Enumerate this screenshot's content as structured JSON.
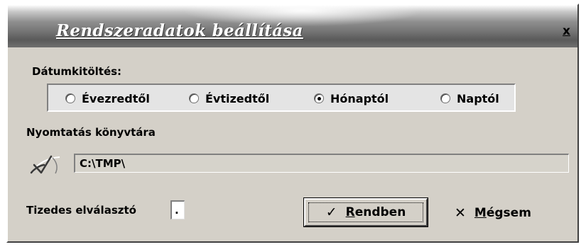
{
  "dialog": {
    "title": "Rendszeradatok beállítása",
    "close_label": "x"
  },
  "date_fill": {
    "label": "Dátumkitöltés:",
    "options": [
      {
        "label": "Évezredtől",
        "selected": false
      },
      {
        "label": "Évtizedtől",
        "selected": false
      },
      {
        "label": "Hónaptól",
        "selected": true
      },
      {
        "label": "Naptól",
        "selected": false
      }
    ]
  },
  "print_dir": {
    "label": "Nyomtatás könyvtára",
    "value": "C:\\TMP\\",
    "browse_icon": "check-icon"
  },
  "decimal": {
    "label": "Tizedes elválasztó",
    "value": "."
  },
  "buttons": {
    "ok_icon": "✓",
    "ok_mnemonic": "R",
    "ok_rest": "endben",
    "cancel_icon": "✕",
    "cancel_mnemonic": "M",
    "cancel_rest": "égsem"
  }
}
